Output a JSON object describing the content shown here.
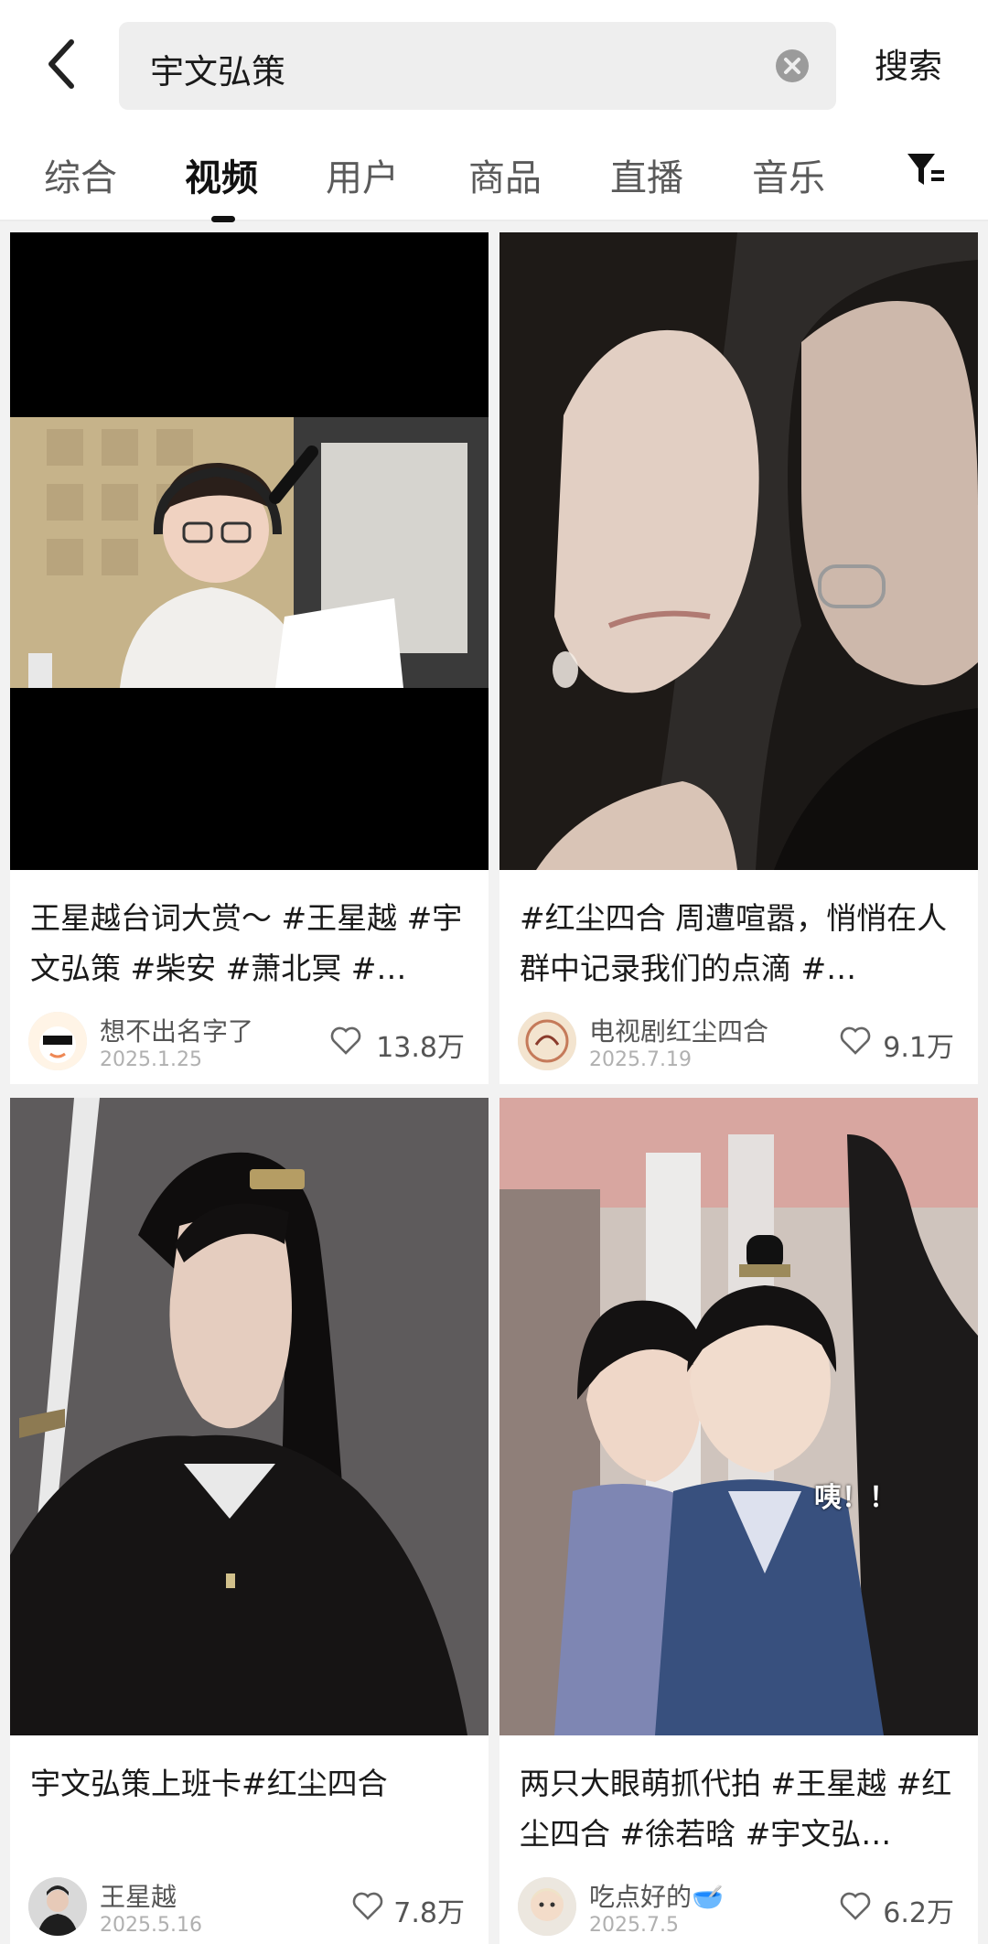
{
  "search": {
    "back_icon": "chevron-left-icon",
    "query": "宇文弘策",
    "clear_icon": "clear-circle-icon",
    "submit_label": "搜索"
  },
  "tabs": [
    {
      "label": "综合",
      "active": false
    },
    {
      "label": "视频",
      "active": true
    },
    {
      "label": "用户",
      "active": false
    },
    {
      "label": "商品",
      "active": false
    },
    {
      "label": "直播",
      "active": false
    },
    {
      "label": "音乐",
      "active": false
    }
  ],
  "filter_icon": "filter-icon",
  "results": [
    {
      "title": "王星越台词大赏～ #王星越 #宇文弘策 #柴安 #萧北冥 #…",
      "author": "想不出名字了",
      "date": "2025.1.25",
      "likes": "13.8万"
    },
    {
      "title": "#红尘四合 周遭喧嚣，悄悄在人群中记录我们的点滴 #…",
      "author": "电视剧红尘四合",
      "date": "2025.7.19",
      "likes": "9.1万"
    },
    {
      "title": "宇文弘策上班卡#红尘四合",
      "author": "王星越",
      "date": "2025.5.16",
      "likes": "7.8万"
    },
    {
      "title": "两只大眼萌抓代拍 #王星越 #红尘四合 #徐若晗 #宇文弘…",
      "author": "吃点好的🥣",
      "date": "2025.7.5",
      "likes": "6.2万",
      "overlay_text": "咦！！"
    }
  ],
  "colors": {
    "background": "#f2f2f2",
    "card": "#ffffff",
    "active_tab": "#111111",
    "inactive_tab": "#5a5a5a",
    "meta_text": "#b0b0b0"
  }
}
